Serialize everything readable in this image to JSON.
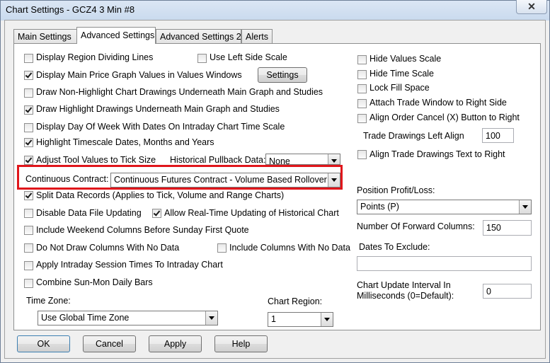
{
  "window": {
    "title": "Chart Settings - GCZ4  3 Min   #8",
    "close_glyph": "✕"
  },
  "tabs": [
    "Main Settings",
    "Advanced Settings",
    "Advanced Settings 2",
    "Alerts"
  ],
  "active_tab": "Advanced Settings",
  "left": {
    "display_region_dividing_lines": "Display Region Dividing Lines",
    "use_left_side_scale": "Use Left Side Scale",
    "display_main_price_graph_values": "Display Main Price Graph Values in Values Windows",
    "settings_button": "Settings",
    "draw_non_highlight": "Draw Non-Highlight Chart Drawings Underneath Main Graph and Studies",
    "draw_highlight": "Draw Highlight Drawings Underneath Main Graph and Studies",
    "display_day_of_week": "Display Day Of Week With Dates On Intraday Chart Time Scale",
    "highlight_timescale": "Highlight Timescale Dates, Months and Years",
    "adjust_tool_values": "Adjust Tool Values to Tick Size",
    "historical_pullback_label": "Historical Pullback Data:",
    "historical_pullback_value": "None",
    "continuous_contract_label": "Continuous Contract:",
    "continuous_contract_value": "Continuous Futures Contract - Volume Based Rollover",
    "split_data_records": "Split Data Records (Applies to Tick, Volume and Range Charts)",
    "disable_data_file_updating": "Disable Data File Updating",
    "allow_realtime_updating": "Allow Real-Time Updating of Historical Chart",
    "include_weekend_columns": "Include Weekend Columns Before Sunday First Quote",
    "do_not_draw_columns": "Do Not Draw Columns With No Data",
    "include_columns_no_data": "Include Columns With No Data",
    "apply_intraday_session": "Apply Intraday Session Times To Intraday Chart",
    "combine_sun_mon": "Combine Sun-Mon Daily Bars",
    "time_zone_label": "Time Zone:",
    "time_zone_value": "Use Global Time Zone",
    "chart_region_label": "Chart Region:",
    "chart_region_value": "1"
  },
  "right": {
    "hide_values_scale": "Hide Values Scale",
    "hide_time_scale": "Hide Time Scale",
    "lock_fill_space": "Lock Fill Space",
    "attach_trade_window": "Attach Trade Window to Right Side",
    "align_order_cancel": "Align Order Cancel (X) Button to Right",
    "trade_drawings_left_align_label": "Trade Drawings Left Align",
    "trade_drawings_left_align_value": "100",
    "align_trade_drawings_text": "Align Trade Drawings Text to Right",
    "position_pl_label": "Position Profit/Loss:",
    "position_pl_value": "Points (P)",
    "forward_columns_label": "Number Of Forward Columns:",
    "forward_columns_value": "150",
    "dates_to_exclude_label": "Dates To Exclude:",
    "dates_to_exclude_value": "",
    "update_interval_label_1": "Chart Update Interval In",
    "update_interval_label_2": "Milliseconds (0=Default):",
    "update_interval_value": "0"
  },
  "buttons": {
    "ok": "OK",
    "cancel": "Cancel",
    "apply": "Apply",
    "help": "Help"
  },
  "colors": {
    "highlight": "#e0161b"
  }
}
